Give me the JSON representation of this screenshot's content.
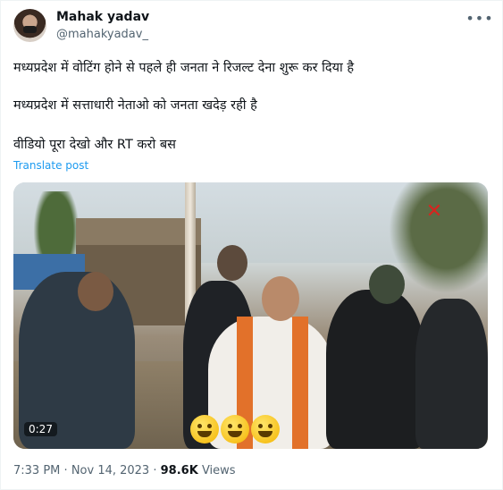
{
  "author": {
    "name": "Mahak yadav",
    "handle": "@mahakyadav_"
  },
  "more_icon": "more-horizontal-icon",
  "tweet": {
    "lines": [
      "मध्यप्रदेश में वोटिंग होने से पहले ही जनता ने रिजल्ट देना शुरू कर दिया है",
      "मध्यप्रदेश में सत्ताधारी नेताओ को जनता खदेड़ रही है",
      "वीडियो पूरा देखो और RT करो बस"
    ],
    "translate_label": "Translate post"
  },
  "media": {
    "duration": "0:27",
    "emojis": [
      "laughing-emoji",
      "laughing-emoji",
      "squinting-laughing-emoji"
    ]
  },
  "meta": {
    "time": "7:33 PM",
    "separator": "·",
    "date": "Nov 14, 2023",
    "views_count": "98.6K",
    "views_label": "Views"
  },
  "colors": {
    "link": "#1d9bf0",
    "secondary_text": "#536471",
    "primary_text": "#0f1419"
  }
}
